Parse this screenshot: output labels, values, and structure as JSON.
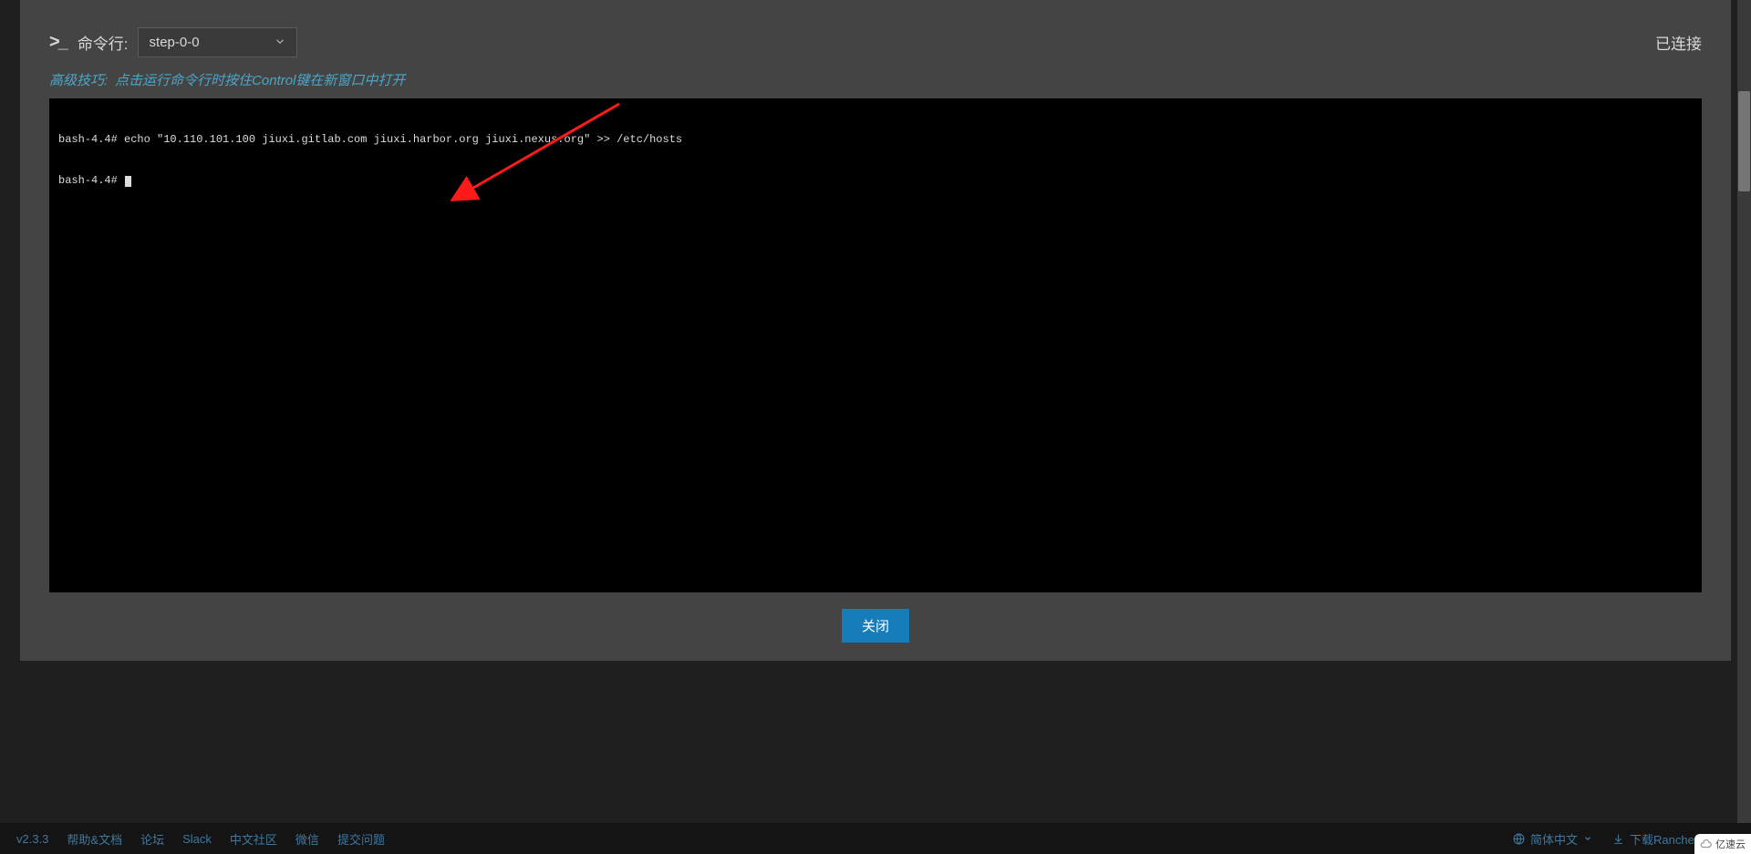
{
  "header": {
    "label": "命令行:",
    "select_value": "step-0-0",
    "status": "已连接"
  },
  "tip": {
    "link": "高级技巧:",
    "text": "点击运行命令行时按住Control键在新窗口中打开"
  },
  "terminal": {
    "line1": "bash-4.4# echo \"10.110.101.100 jiuxi.gitlab.com jiuxi.harbor.org jiuxi.nexus.org\" >> /etc/hosts",
    "line2": "bash-4.4# "
  },
  "buttons": {
    "close": "关闭"
  },
  "footer": {
    "version": "v2.3.3",
    "links": [
      "帮助&文档",
      "论坛",
      "Slack",
      "中文社区",
      "微信",
      "提交问题"
    ],
    "language": "简体中文",
    "download": "下载Rancher CLI"
  },
  "watermark": "亿速云"
}
